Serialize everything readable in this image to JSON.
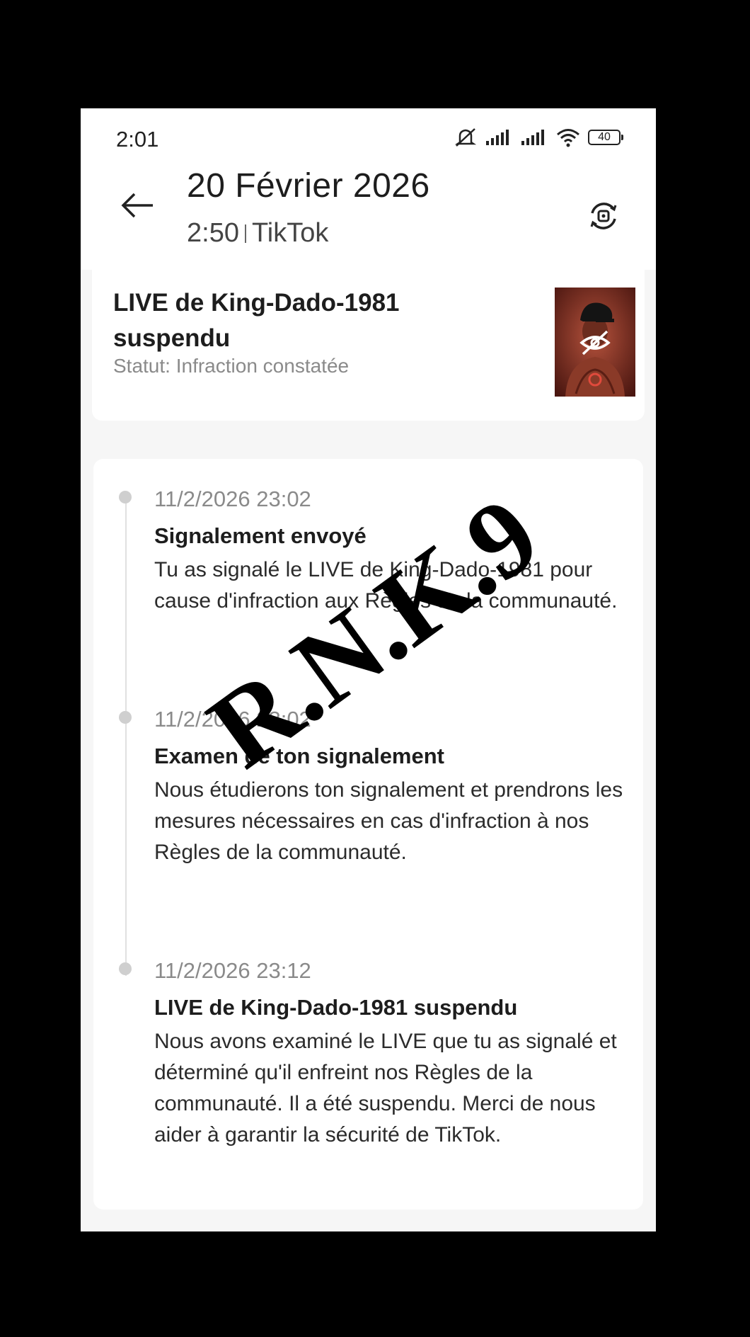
{
  "status_bar": {
    "time": "2:01",
    "battery": "40"
  },
  "header": {
    "date": "20 Février 2026",
    "time": "2:50",
    "app": "TikTok"
  },
  "notification": {
    "title": "LIVE de King-Dado-1981 suspendu",
    "status": "Statut: Infraction constatée"
  },
  "timeline": [
    {
      "time": "11/2/2026 23:02",
      "title": "Signalement envoyé",
      "description": "Tu as signalé le LIVE de King-Dado-1981 pour cause d'infraction aux Règles de la communauté."
    },
    {
      "time": "11/2/2026 23:02",
      "title": "Examen de ton signalement",
      "description": "Nous étudierons ton signalement et prendrons les mesures nécessaires en cas d'infraction à nos Règles de la communauté."
    },
    {
      "time": "11/2/2026 23:12",
      "title": "LIVE de King-Dado-1981 suspendu",
      "description": "Nous avons examiné le LIVE que tu as signalé et déterminé qu'il enfreint nos Règles de la communauté. Il a été suspendu. Merci de nous aider à garantir la sécurité de TikTok."
    }
  ],
  "watermark": "R.N.K.9"
}
